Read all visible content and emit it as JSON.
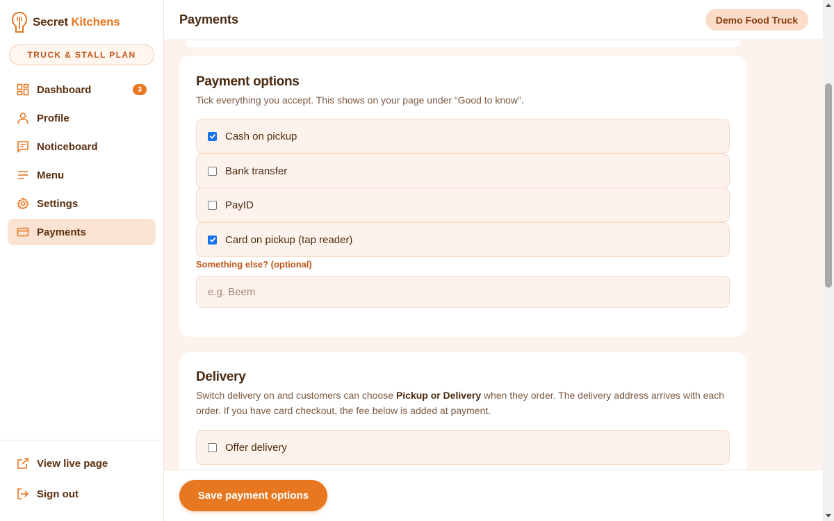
{
  "brand": {
    "name_part1": "Secret",
    "name_part2": "Kitchens",
    "plan": "TRUCK & STALL PLAN"
  },
  "sidebar": {
    "items": [
      {
        "label": "Dashboard",
        "icon": "dashboard-icon",
        "badge": "3"
      },
      {
        "label": "Profile",
        "icon": "user-icon"
      },
      {
        "label": "Noticeboard",
        "icon": "message-icon"
      },
      {
        "label": "Menu",
        "icon": "menu-lines-icon"
      },
      {
        "label": "Settings",
        "icon": "gear-icon"
      },
      {
        "label": "Payments",
        "icon": "credit-card-icon",
        "active": true
      }
    ],
    "bottom_items": [
      {
        "label": "View live page",
        "icon": "external-link-icon"
      },
      {
        "label": "Sign out",
        "icon": "sign-out-icon"
      }
    ]
  },
  "header": {
    "title": "Payments",
    "store": "Demo Food Truck"
  },
  "payment_options": {
    "title": "Payment options",
    "description": "Tick everything you accept. This shows on your page under “Good to know”.",
    "options": [
      {
        "label": "Cash on pickup",
        "checked": true
      },
      {
        "label": "Bank transfer",
        "checked": false
      },
      {
        "label": "PayID",
        "checked": false
      },
      {
        "label": "Card on pickup (tap reader)",
        "checked": true
      }
    ],
    "other_label": "Something else? (optional)",
    "other_placeholder": "e.g. Beem",
    "other_value": ""
  },
  "delivery": {
    "title": "Delivery",
    "description_pre": "Switch delivery on and customers can choose ",
    "description_bold": "Pickup or Delivery",
    "description_post": " when they order. The delivery address arrives with each order. If you have card checkout, the fee below is added at payment.",
    "offer_label": "Offer delivery",
    "offer_checked": false
  },
  "save_button": "Save payment options",
  "colors": {
    "accent": "#e87722",
    "brand_dark": "#5a2f10",
    "background": "#fdf3ec",
    "active_nav": "#fbe3d3",
    "checkbox": "#1a73e8"
  }
}
